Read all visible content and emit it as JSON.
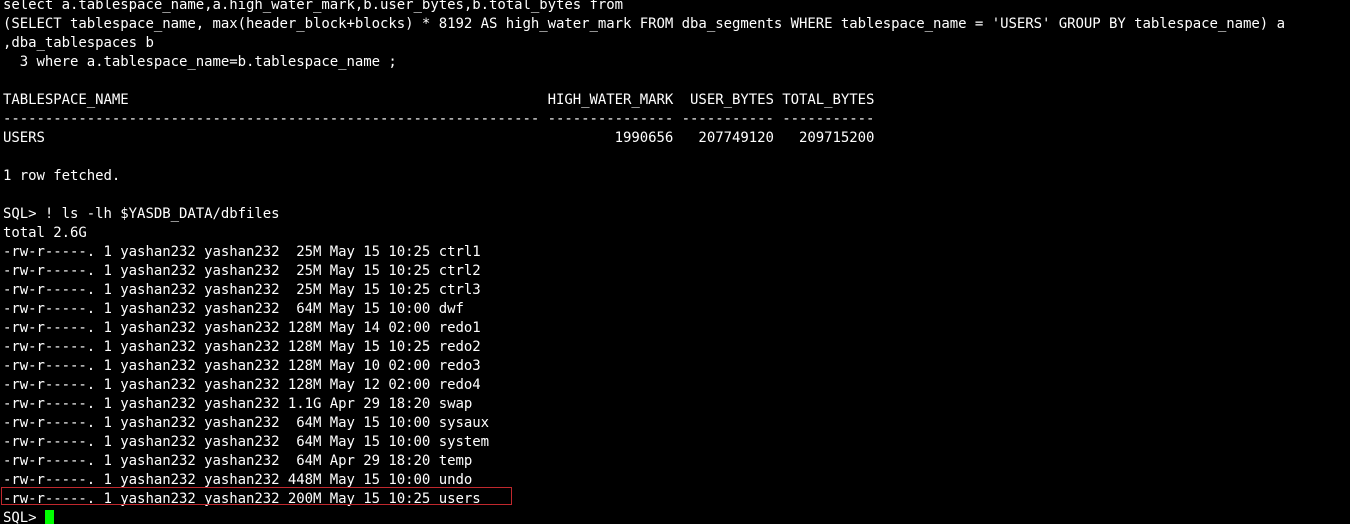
{
  "terminal": {
    "lines": [
      "select a.tablespace_name,a.high_water_mark,b.user_bytes,b.total_bytes from",
      "(SELECT tablespace_name, max(header_block+blocks) * 8192 AS high_water_mark FROM dba_segments WHERE tablespace_name = 'USERS' GROUP BY tablespace_name) a",
      ",dba_tablespaces b",
      "  3 where a.tablespace_name=b.tablespace_name ;",
      "",
      "TABLESPACE_NAME                                                  HIGH_WATER_MARK  USER_BYTES TOTAL_BYTES",
      "---------------------------------------------------------------- --------------- ----------- -----------",
      "USERS                                                                    1990656   207749120   209715200",
      "",
      "1 row fetched.",
      "",
      "SQL> ! ls -lh $YASDB_DATA/dbfiles",
      "total 2.6G",
      "-rw-r-----. 1 yashan232 yashan232  25M May 15 10:25 ctrl1",
      "-rw-r-----. 1 yashan232 yashan232  25M May 15 10:25 ctrl2",
      "-rw-r-----. 1 yashan232 yashan232  25M May 15 10:25 ctrl3",
      "-rw-r-----. 1 yashan232 yashan232  64M May 15 10:00 dwf",
      "-rw-r-----. 1 yashan232 yashan232 128M May 14 02:00 redo1",
      "-rw-r-----. 1 yashan232 yashan232 128M May 15 10:25 redo2",
      "-rw-r-----. 1 yashan232 yashan232 128M May 10 02:00 redo3",
      "-rw-r-----. 1 yashan232 yashan232 128M May 12 02:00 redo4",
      "-rw-r-----. 1 yashan232 yashan232 1.1G Apr 29 18:20 swap",
      "-rw-r-----. 1 yashan232 yashan232  64M May 15 10:00 sysaux",
      "-rw-r-----. 1 yashan232 yashan232  64M May 15 10:00 system",
      "-rw-r-----. 1 yashan232 yashan232  64M Apr 29 18:20 temp",
      "-rw-r-----. 1 yashan232 yashan232 448M May 15 10:00 undo",
      "-rw-r-----. 1 yashan232 yashan232 200M May 15 10:25 users"
    ],
    "prompt": "SQL> ",
    "colors": {
      "background": "#000000",
      "text": "#ffffff",
      "cursor": "#00ff00",
      "highlight_border": "#c0282d"
    }
  }
}
